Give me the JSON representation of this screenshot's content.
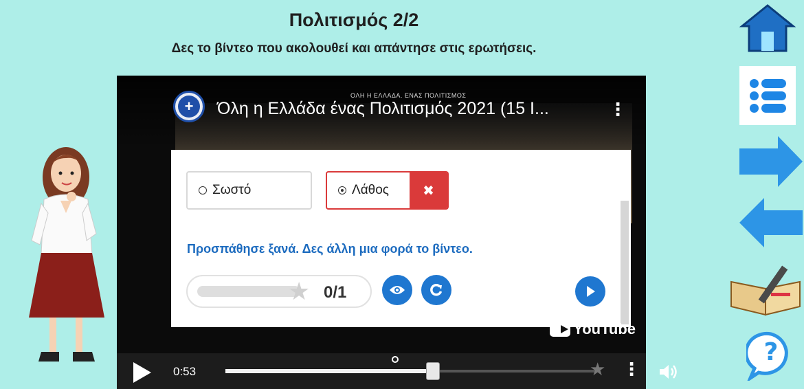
{
  "header": {
    "title": "Πολιτισμός 2/2",
    "subtitle": "Δες το βίντεο που ακολουθεί και απάντησε στις ερωτήσεις."
  },
  "video": {
    "title": "Όλη η Ελλάδα ένας Πολιτισμός 2021 (15 Ι...",
    "overlay_caption": "ΟΛΗ Η ΕΛΛΑΔΑ. ΕΝΑΣ ΠΟΛΙΤΙΣΜΟΣ",
    "channel_logo_icon": "greek-cross-emblem-icon",
    "more_icon": "vertical-dots-icon",
    "watermark": "YouTube"
  },
  "quiz": {
    "options": [
      {
        "label": "Σωστό",
        "selected": false,
        "state": "neutral"
      },
      {
        "label": "Λάθος",
        "selected": true,
        "state": "wrong"
      }
    ],
    "wrong_mark": "✖",
    "feedback": "Προσπάθησε ξανά. Δες άλλη μια φορά το βίντεο.",
    "score": "0/1",
    "buttons": {
      "show_solution_icon": "eye-icon",
      "retry_icon": "retry-icon",
      "next_icon": "play-icon"
    }
  },
  "player": {
    "time": "0:53",
    "progress_fraction": 0.56,
    "knob_label": "○"
  },
  "colors": {
    "background": "#aeeee8",
    "accent_blue": "#1f77d0",
    "wrong_red": "#da3a3a",
    "feedback_blue": "#1c6bbf"
  },
  "nav": {
    "home_icon": "home-icon",
    "menu_icon": "list-menu-icon",
    "next_icon": "arrow-right-icon",
    "prev_icon": "arrow-left-icon",
    "book_icon": "notebook-pencil-icon",
    "help_icon": "help-question-icon",
    "help_label": "?"
  }
}
